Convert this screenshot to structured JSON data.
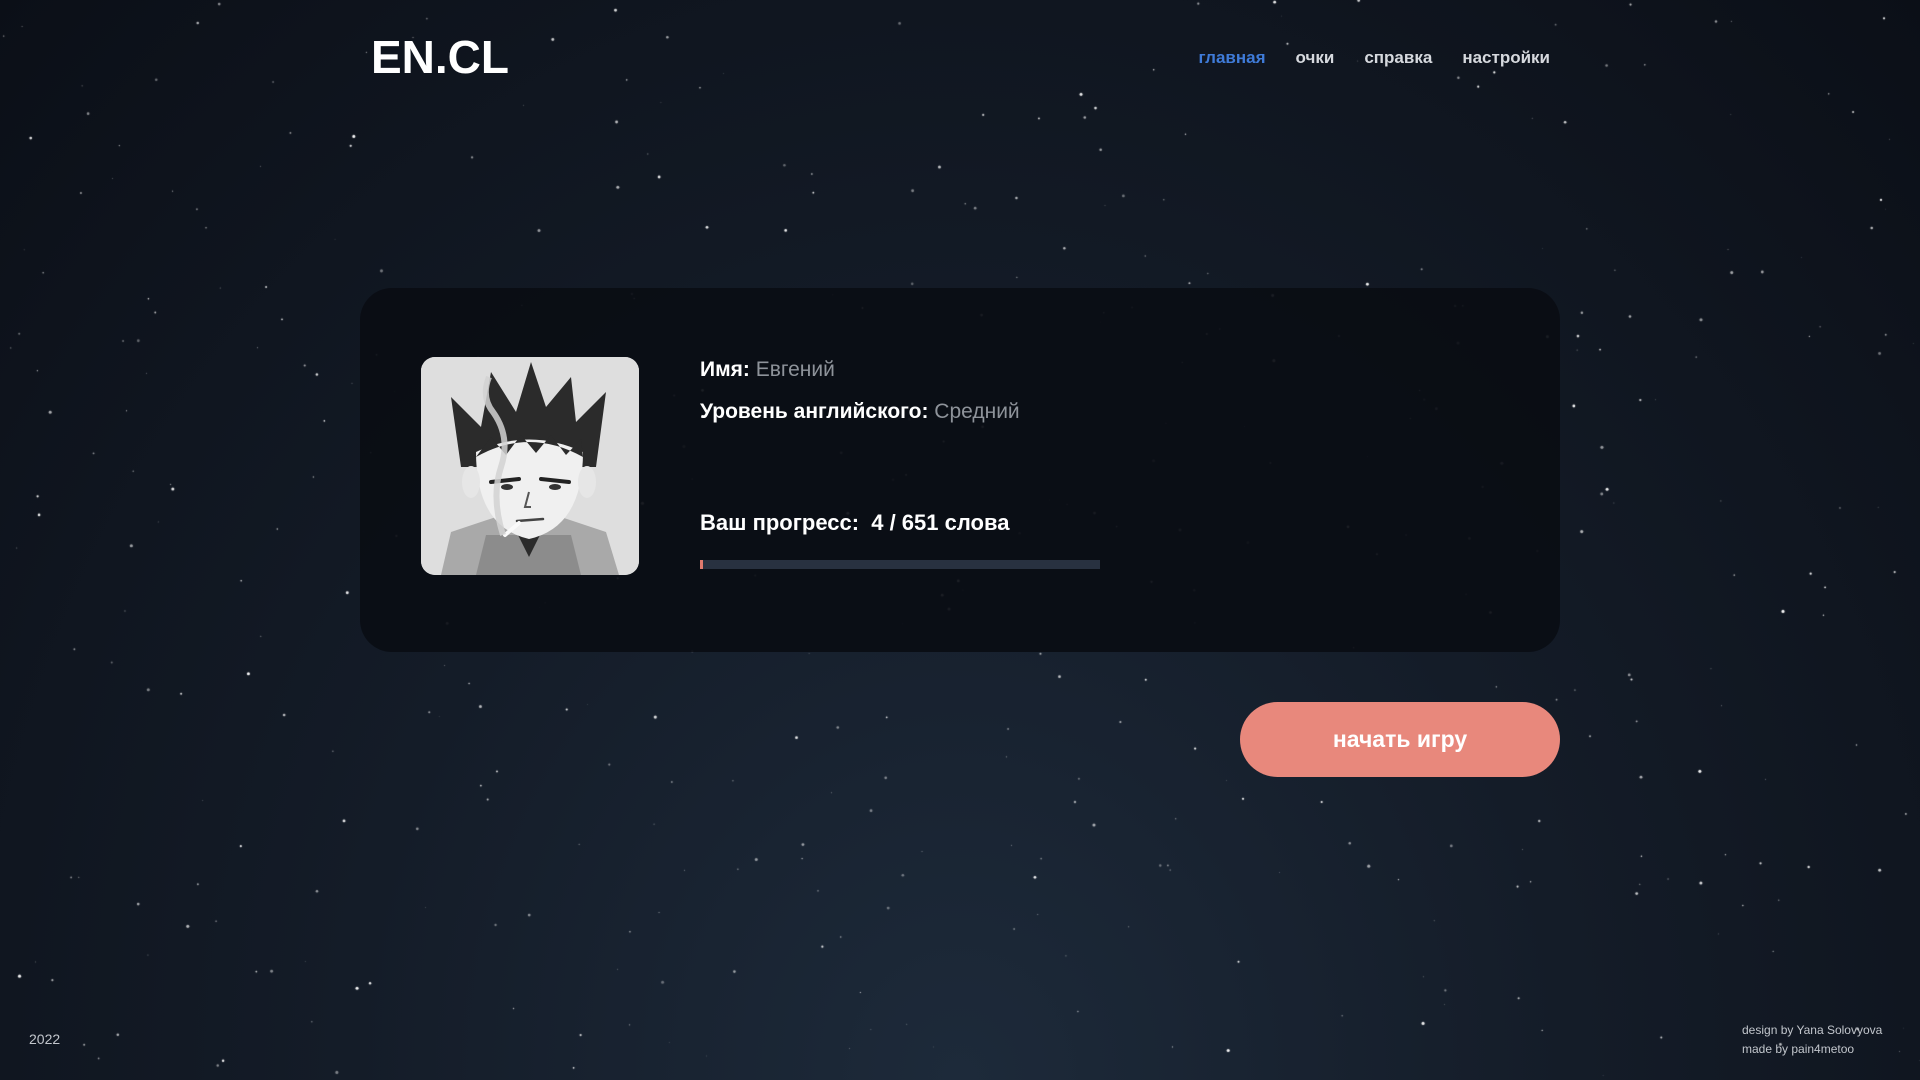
{
  "app": {
    "logo": "EN.CL"
  },
  "nav": {
    "items": [
      {
        "label": "главная",
        "active": true
      },
      {
        "label": "очки",
        "active": false
      },
      {
        "label": "справка",
        "active": false
      },
      {
        "label": "настройки",
        "active": false
      }
    ]
  },
  "profile": {
    "name_label": "Имя:",
    "name_value": "Евгений",
    "level_label": "Уровень английского:",
    "level_value": "Средний",
    "progress_label": "Ваш прогресс:",
    "progress_value": "4 / 651 слова",
    "progress_learned": 4,
    "progress_total": 651
  },
  "actions": {
    "start_label": "начать игру"
  },
  "footer": {
    "year": "2022",
    "design_credit": "design by Yana Solovyova",
    "made_credit": "made by pain4metoo"
  },
  "colors": {
    "accent": "#e8887c",
    "nav_active": "#3f7bd8",
    "background": "#141c28"
  }
}
